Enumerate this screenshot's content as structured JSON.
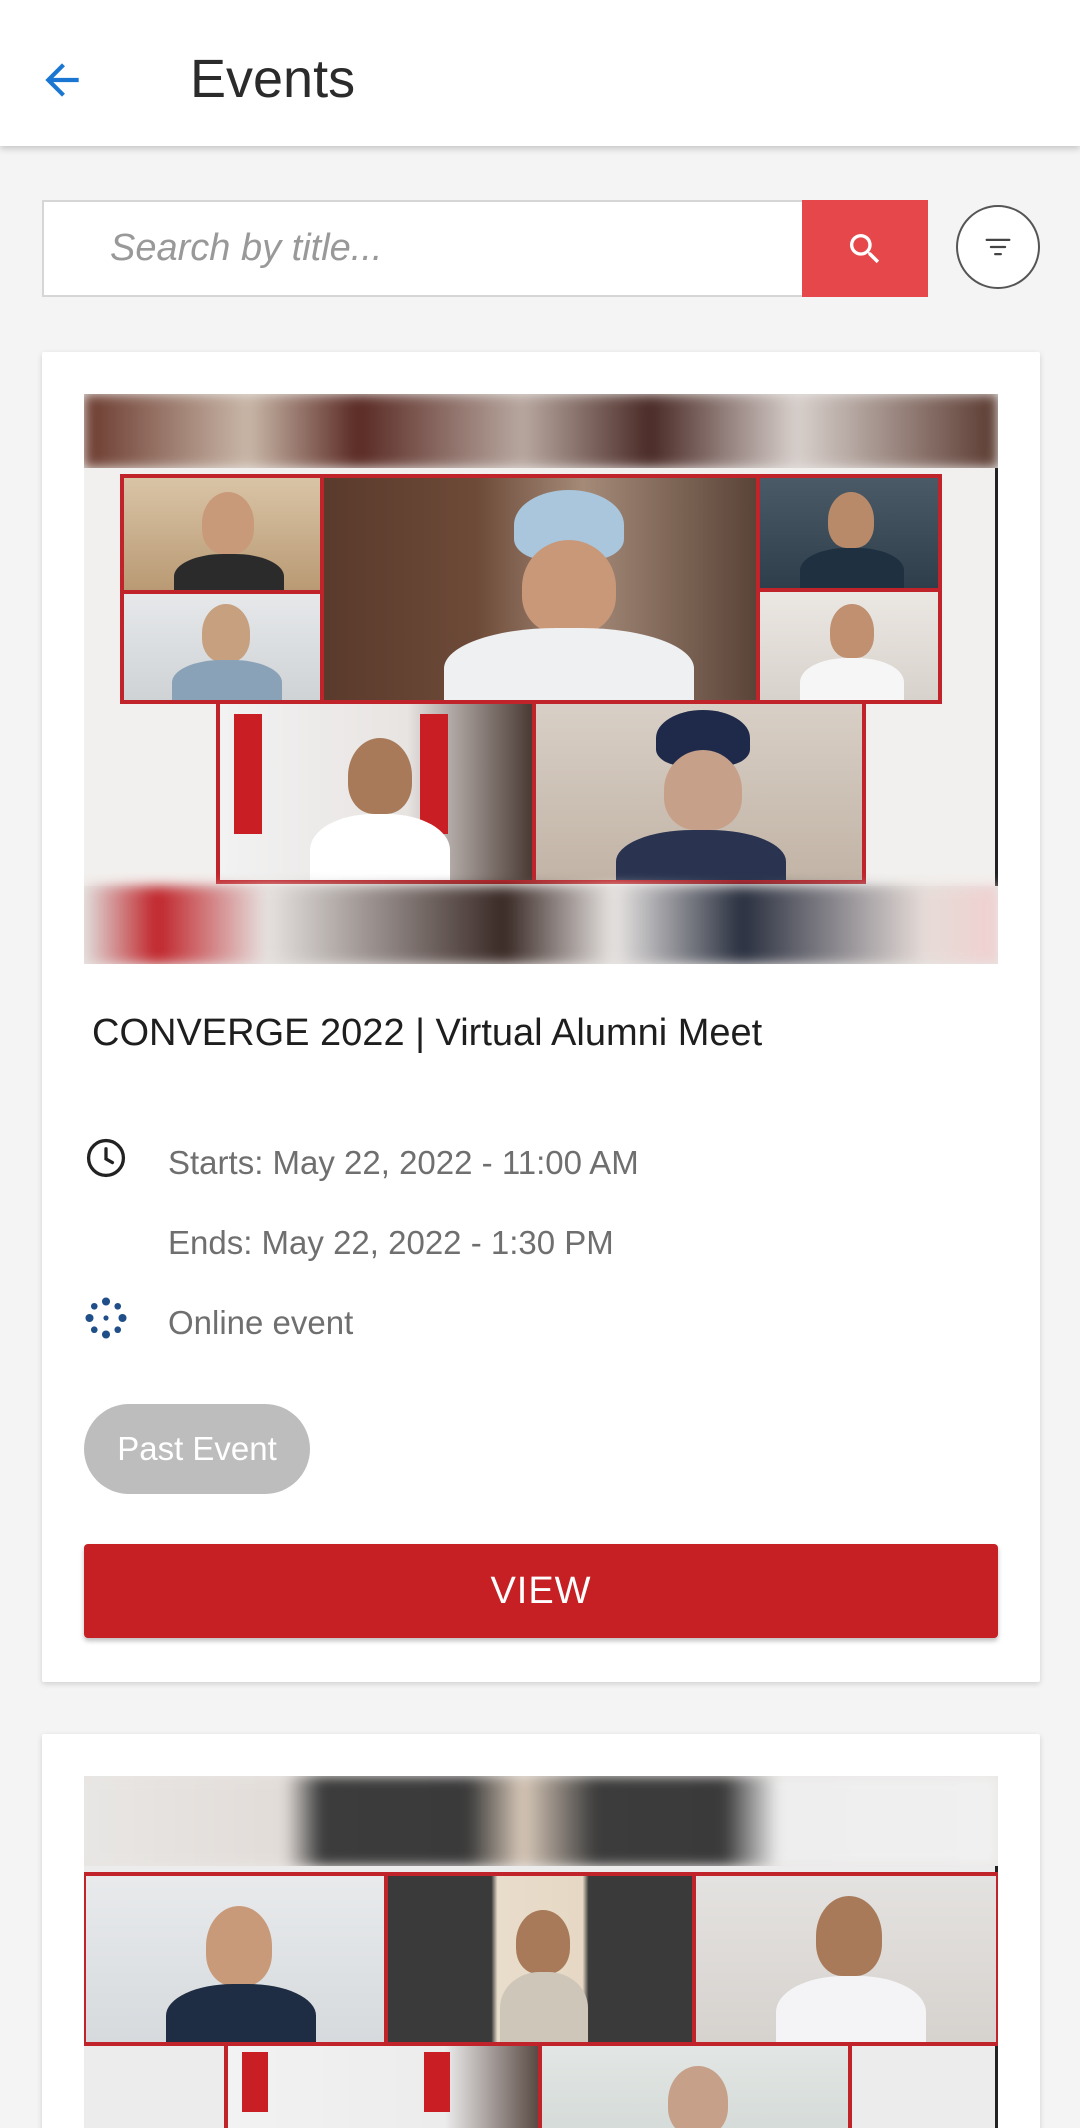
{
  "header": {
    "title": "Events",
    "back_icon": "arrow-left-icon",
    "accent": "#1976d2"
  },
  "search": {
    "placeholder": "Search by title...",
    "value": "",
    "button_color": "#e5474b"
  },
  "events": [
    {
      "title": "CONVERGE 2022 | Virtual Alumni Meet",
      "starts": "Starts: May 22, 2022 - 11:00 AM",
      "ends": "Ends: May 22, 2022 - 1:30 PM",
      "mode": "Online event",
      "badge": "Past Event",
      "action": "VIEW",
      "action_color": "#c62024"
    },
    {
      "title": "",
      "image": "video-call-collage"
    }
  ]
}
